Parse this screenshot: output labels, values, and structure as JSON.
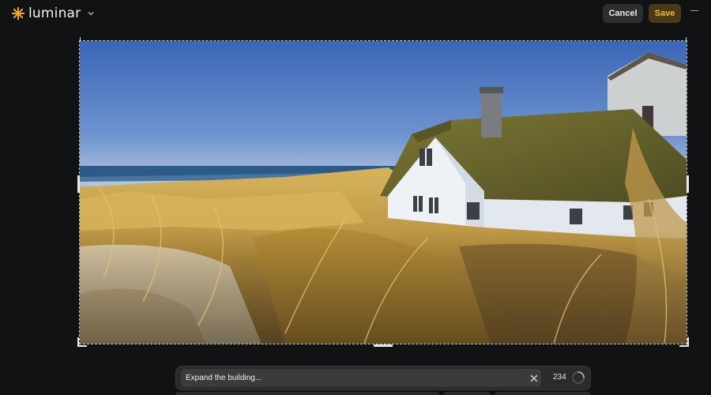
{
  "app": {
    "name": "luminar",
    "brand_color": "#f0a52b"
  },
  "toolbar": {
    "cancel_label": "Cancel",
    "save_label": "Save"
  },
  "prompt": {
    "value": "Expand the building...",
    "counter": "234"
  },
  "icons": [
    "luminar-logo-icon",
    "chevron-down-icon",
    "minimize-icon",
    "close-icon",
    "spinner-icon"
  ],
  "colors": {
    "background": "#111213",
    "save_text": "#f3b53a",
    "save_bg": "#4a3a18",
    "sky_top": "#3e6ab8",
    "sea": "#2b5d8c",
    "grass": "#c9a24a",
    "roof": "#6f6a2e",
    "wall": "#e9eef3"
  }
}
